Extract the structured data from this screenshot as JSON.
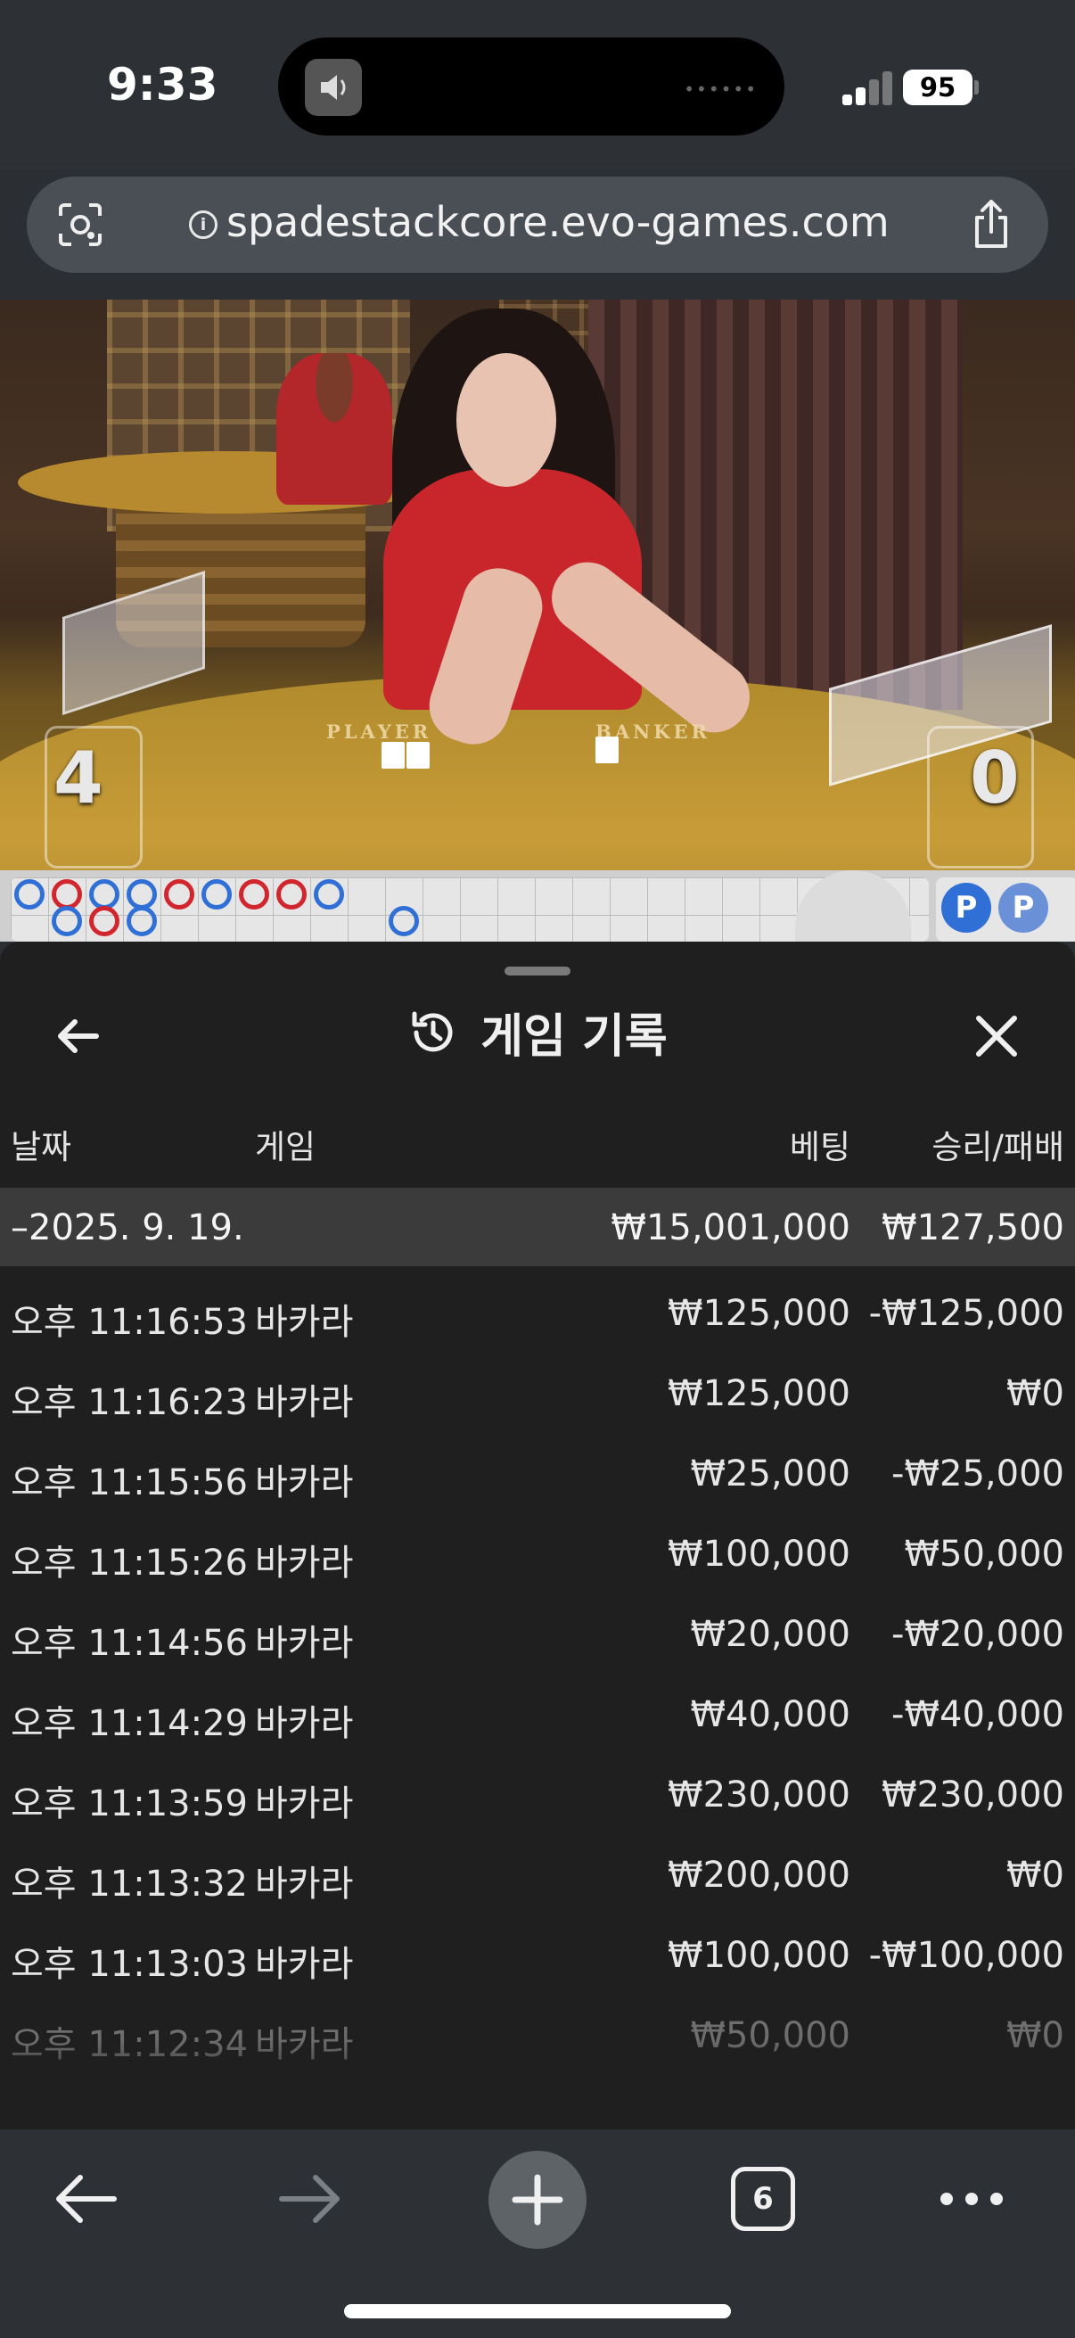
{
  "status_bar": {
    "time": "9:33",
    "battery": "95"
  },
  "browser": {
    "url": "spadestackcore.evo-games.com",
    "tab_count": "6"
  },
  "video": {
    "player_label": "PLAYER",
    "banker_label": "BANKER",
    "player_score": "4",
    "banker_score": "0"
  },
  "road": {
    "beads": [
      "b",
      "r",
      "b",
      "b",
      "r",
      "b",
      "r",
      "r",
      "b",
      "b",
      "r",
      "b",
      "b"
    ],
    "badge_label": "P"
  },
  "history": {
    "title": "게임 기록",
    "columns": {
      "date": "날짜",
      "game": "게임",
      "bet": "베팅",
      "win_loss": "승리/패배"
    },
    "day": {
      "date": "–2025. 9. 19.",
      "bet_total": "₩15,001,000",
      "win_loss_total": "₩127,500"
    },
    "rows": [
      {
        "time": "오후 11:16:53",
        "game": "바카라",
        "bet": "₩125,000",
        "result": "-₩125,000"
      },
      {
        "time": "오후 11:16:23",
        "game": "바카라",
        "bet": "₩125,000",
        "result": "₩0"
      },
      {
        "time": "오후 11:15:56",
        "game": "바카라",
        "bet": "₩25,000",
        "result": "-₩25,000"
      },
      {
        "time": "오후 11:15:26",
        "game": "바카라",
        "bet": "₩100,000",
        "result": "₩50,000"
      },
      {
        "time": "오후 11:14:56",
        "game": "바카라",
        "bet": "₩20,000",
        "result": "-₩20,000"
      },
      {
        "time": "오후 11:14:29",
        "game": "바카라",
        "bet": "₩40,000",
        "result": "-₩40,000"
      },
      {
        "time": "오후 11:13:59",
        "game": "바카라",
        "bet": "₩230,000",
        "result": "₩230,000"
      },
      {
        "time": "오후 11:13:32",
        "game": "바카라",
        "bet": "₩200,000",
        "result": "₩0"
      },
      {
        "time": "오후 11:13:03",
        "game": "바카라",
        "bet": "₩100,000",
        "result": "-₩100,000"
      },
      {
        "time": "오후 11:12:34",
        "game": "바카라",
        "bet": "₩50,000",
        "result": "₩0"
      }
    ]
  },
  "icons": {
    "back": "arrow-left-icon",
    "close": "close-icon",
    "history": "history-icon",
    "camera": "camera-search-icon",
    "info": "info-icon",
    "share": "share-icon",
    "forward": "arrow-right-icon",
    "new_tab": "plus-icon",
    "more": "more-icon"
  },
  "colors": {
    "panel_bg": "#1f1f1f",
    "day_row_bg": "#3b3b3b",
    "player_blue": "#2f6fd6",
    "banker_red": "#d2262f"
  }
}
